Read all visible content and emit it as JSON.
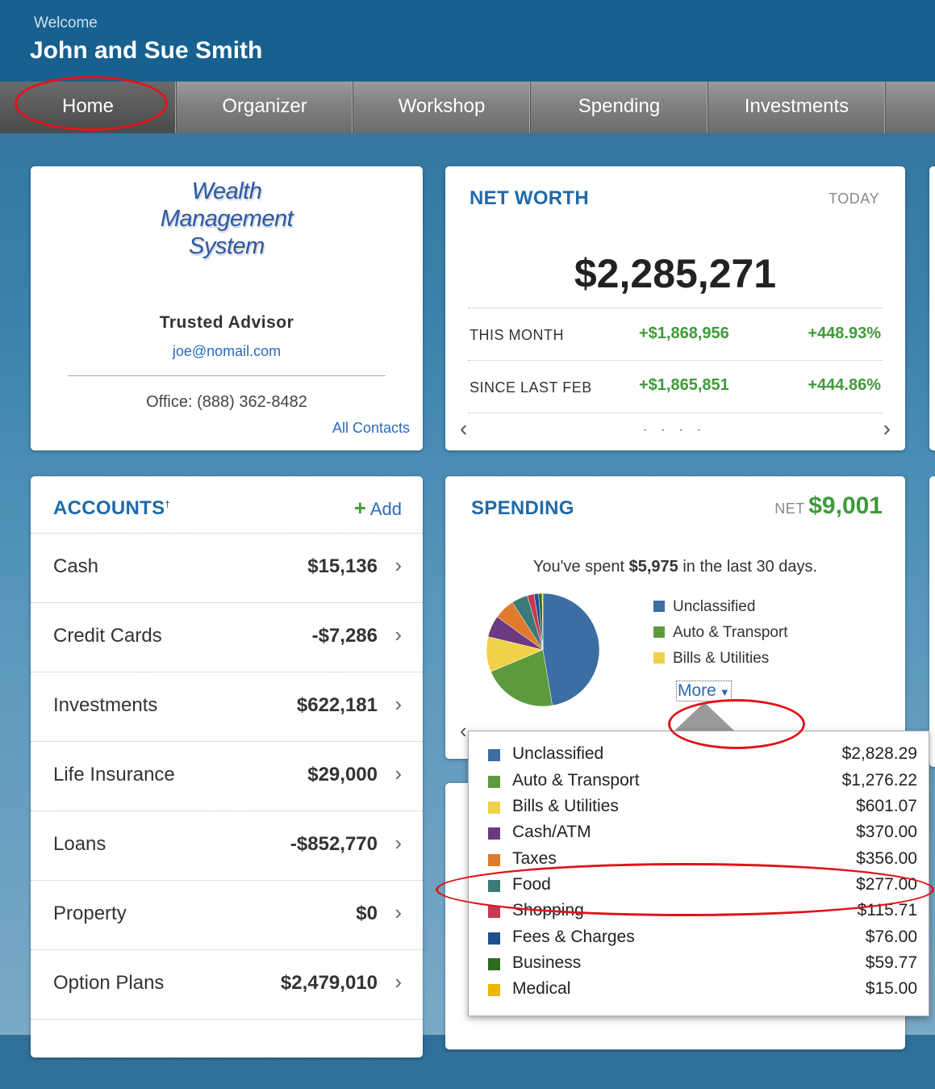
{
  "header": {
    "welcome": "Welcome",
    "user_name": "John and Sue Smith"
  },
  "nav": {
    "tabs": [
      "Home",
      "Organizer",
      "Workshop",
      "Spending",
      "Investments"
    ],
    "active": "Home"
  },
  "advisor": {
    "logo_line1": "Wealth",
    "logo_line2": "Management",
    "logo_line3": "System",
    "title": "Trusted Advisor",
    "email": "joe@nomail.com",
    "phone": "Office: (888) 362-8482",
    "all_contacts": "All Contacts"
  },
  "net_worth": {
    "title": "NET WORTH",
    "period": "TODAY",
    "value": "$2,285,271",
    "rows": [
      {
        "label": "THIS MONTH",
        "change": "+$1,868,956",
        "pct": "+448.93%"
      },
      {
        "label": "SINCE LAST FEB",
        "change": "+$1,865,851",
        "pct": "+444.86%"
      }
    ],
    "prev": "‹",
    "next": "›",
    "dots": "• • • •"
  },
  "accounts": {
    "title": "ACCOUNTS",
    "title_mark": "†",
    "add_label": "Add",
    "items": [
      {
        "label": "Cash",
        "value": "$15,136"
      },
      {
        "label": "Credit Cards",
        "value": "-$7,286"
      },
      {
        "label": "Investments",
        "value": "$622,181"
      },
      {
        "label": "Life Insurance",
        "value": "$29,000"
      },
      {
        "label": "Loans",
        "value": "-$852,770"
      },
      {
        "label": "Property",
        "value": "$0"
      },
      {
        "label": "Option Plans",
        "value": "$2,479,010"
      }
    ]
  },
  "spending": {
    "title": "SPENDING",
    "net_label": "NET",
    "net_value": "$9,001",
    "spent_prefix": "You've spent ",
    "spent_amount": "$5,975",
    "spent_suffix": " in the last 30 days.",
    "legend": [
      {
        "name": "Unclassified",
        "color": "#3c6ea3"
      },
      {
        "name": "Auto & Transport",
        "color": "#5c9a3c"
      },
      {
        "name": "Bills & Utilities",
        "color": "#f0d24a"
      }
    ],
    "more_label": "More",
    "categories": [
      {
        "name": "Unclassified",
        "amount": "$2,828.29",
        "value": 2828.29,
        "color": "#3c6ea3"
      },
      {
        "name": "Auto & Transport",
        "amount": "$1,276.22",
        "value": 1276.22,
        "color": "#5c9a3c"
      },
      {
        "name": "Bills & Utilities",
        "amount": "$601.07",
        "value": 601.07,
        "color": "#f0d24a"
      },
      {
        "name": "Cash/ATM",
        "amount": "$370.00",
        "value": 370.0,
        "color": "#6b3a80"
      },
      {
        "name": "Taxes",
        "amount": "$356.00",
        "value": 356.0,
        "color": "#e07b2e"
      },
      {
        "name": "Food",
        "amount": "$277.00",
        "value": 277.0,
        "color": "#3b7a78"
      },
      {
        "name": "Shopping",
        "amount": "$115.71",
        "value": 115.71,
        "color": "#c8384e"
      },
      {
        "name": "Fees & Charges",
        "amount": "$76.00",
        "value": 76.0,
        "color": "#1f4f8f"
      },
      {
        "name": "Business",
        "amount": "$59.77",
        "value": 59.77,
        "color": "#2d6b1e"
      },
      {
        "name": "Medical",
        "amount": "$15.00",
        "value": 15.0,
        "color": "#f0b400"
      }
    ]
  }
}
